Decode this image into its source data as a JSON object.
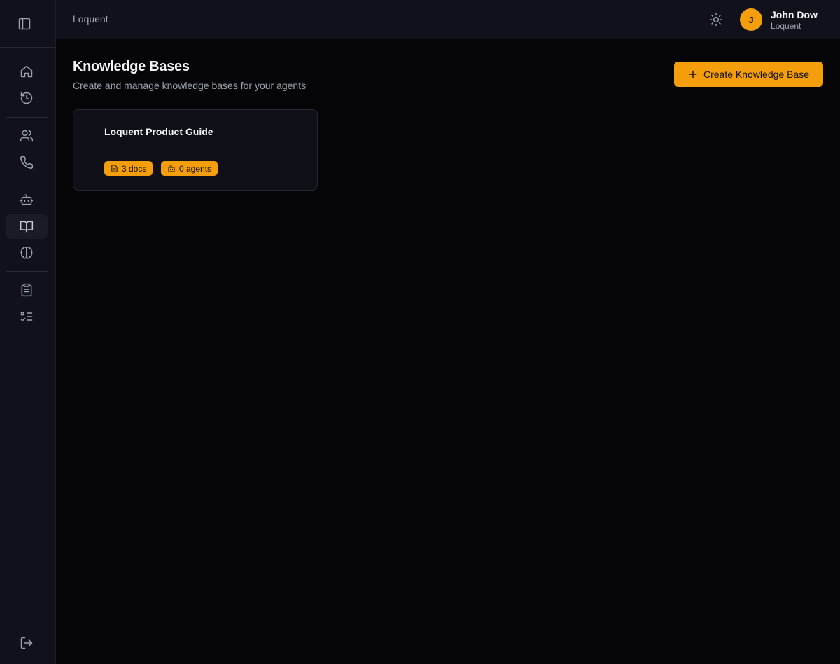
{
  "header": {
    "brand": "Loquent",
    "user": {
      "initial": "J",
      "name": "John Dow",
      "org": "Loquent"
    }
  },
  "sidebar": {
    "toggle_icon": "sidebar-panel-icon",
    "groups": [
      [
        "home-icon",
        "history-icon"
      ],
      [
        "users-icon",
        "phone-icon"
      ],
      [
        "bot-icon",
        "book-open-icon",
        "brain-icon"
      ],
      [
        "clipboard-icon",
        "checklist-icon"
      ]
    ],
    "active_item": "book-open-icon",
    "footer_icon": "log-out-icon"
  },
  "page": {
    "title": "Knowledge Bases",
    "subtitle": "Create and manage knowledge bases for your agents",
    "create_button_label": "Create Knowledge Base"
  },
  "knowledge_bases": [
    {
      "name": "Loquent Product Guide",
      "docs_label": "3 docs",
      "agents_label": "0 agents"
    }
  ],
  "colors": {
    "accent": "#f59e0b",
    "background": "#050508",
    "surface": "#10111a"
  }
}
